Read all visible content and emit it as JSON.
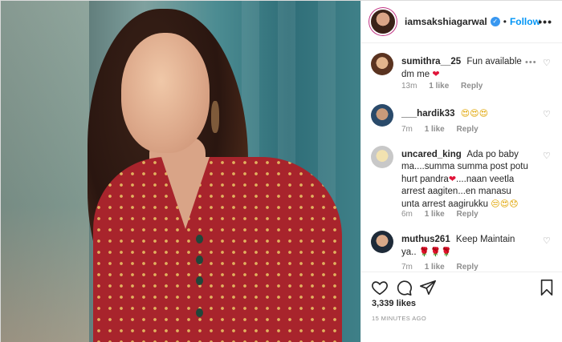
{
  "post": {
    "username": "iamsakshiagarwal",
    "verified_mark": "✓",
    "separator": "•",
    "follow_label": "Follow",
    "more_icon": "•••",
    "likes": "3,339 likes",
    "timestamp": "15 MINUTES AGO"
  },
  "icons": {
    "heart": "heart-icon",
    "comment": "comment-icon",
    "share": "paper-plane-icon",
    "save": "bookmark-icon"
  },
  "colors": {
    "follow": "#0095f6",
    "verified": "#3897f0",
    "muted": "#8e8e8e",
    "text": "#262626"
  },
  "comments": [
    {
      "username": "sumithra__25",
      "text": "Fun available dm me",
      "emojis": "❤",
      "time": "13m",
      "likes": "1 like",
      "reply": "Reply",
      "more": "•••",
      "like_icon": "♡"
    },
    {
      "username": "___hardik33",
      "text": "",
      "emojis": "😍😍😍",
      "time": "7m",
      "likes": "1 like",
      "reply": "Reply",
      "like_icon": "♡"
    },
    {
      "username": "uncared_king",
      "text_1": "Ada po baby ma....summa summa post potu hurt pandra",
      "emoji_1": "❤",
      "text_2": "....naan veetla arrest aagiten...en manasu unta arrest aagirukku",
      "emojis": "😒😍😞",
      "time": "6m",
      "likes": "1 like",
      "reply": "Reply",
      "like_icon": "♡"
    },
    {
      "username": "muthus261",
      "text": "Keep Maintain ya..",
      "emojis": "🌹🌹🌹",
      "time": "7m",
      "likes": "1 like",
      "reply": "Reply",
      "like_icon": "♡"
    }
  ]
}
